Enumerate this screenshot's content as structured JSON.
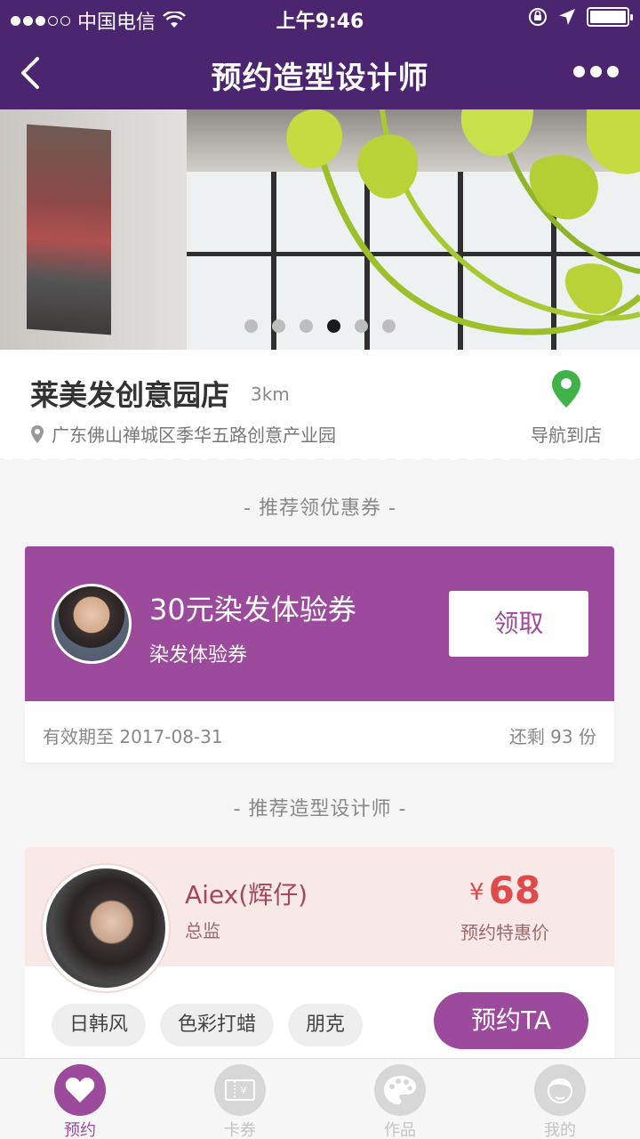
{
  "status_bar": {
    "carrier": "中国电信",
    "time": "上午9:46",
    "signal_bars_filled": 3,
    "signal_bars_total": 5,
    "battery_level": 1.0,
    "icons": [
      "wifi-icon",
      "rotation-lock-icon",
      "location-arrow-icon",
      "battery-icon"
    ]
  },
  "nav": {
    "title": "预约造型设计师",
    "back_icon": "chevron-left-icon",
    "more_icon": "more-dots-icon"
  },
  "banner": {
    "page_count": 6,
    "active_index": 3
  },
  "store": {
    "name": "莱美发创意园店",
    "distance": "3km",
    "address": "广东佛山禅城区季华五路创意产业园",
    "navigate_label": "导航到店"
  },
  "coupon_section": {
    "title": "- 推荐领优惠券 -"
  },
  "coupon": {
    "title": "30元染发体验券",
    "subtitle": "染发体验券",
    "claim_label": "领取",
    "validity": "有效期至 2017-08-31",
    "remaining": "还剩 93 份"
  },
  "stylist_section": {
    "title": "- 推荐造型设计师 -"
  },
  "stylist": {
    "name": "Aiex(辉仔)",
    "role": "总监",
    "currency": "¥",
    "price": "68",
    "price_label": "预约特惠价",
    "tags": [
      "日韩风",
      "色彩打蜡",
      "朋克"
    ],
    "book_label": "预约TA"
  },
  "tabbar": {
    "items": [
      {
        "label": "预约",
        "icon": "heart-icon",
        "active": true
      },
      {
        "label": "卡券",
        "icon": "ticket-icon",
        "active": false
      },
      {
        "label": "作品",
        "icon": "palette-icon",
        "active": false
      },
      {
        "label": "我的",
        "icon": "profile-face-icon",
        "active": false
      }
    ]
  },
  "colors": {
    "header": "#4c2570",
    "accent": "#9c4a9c",
    "price": "#e04a4a",
    "nav_pin": "#3fb24a"
  }
}
